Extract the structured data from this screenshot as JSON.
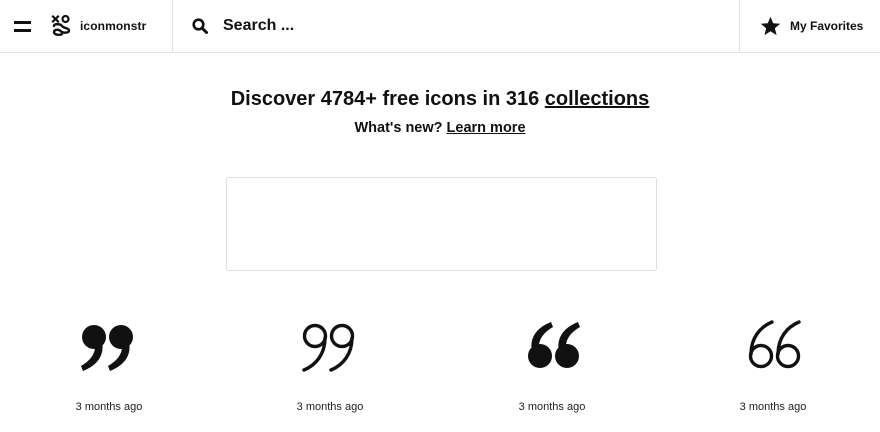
{
  "header": {
    "menu_icon": "hamburger-icon",
    "logo_icon": "iconmonstr-logo-icon",
    "logo_text": "iconmonstr",
    "search_icon": "search-icon",
    "search_placeholder": "Search ...",
    "favorites_icon": "star-icon",
    "favorites_label": "My Favorites"
  },
  "hero": {
    "title_prefix": "Discover 4784+ free icons in 316 ",
    "title_link": "collections",
    "subtitle_prefix": "What's new? ",
    "subtitle_link": "Learn more"
  },
  "icons": [
    {
      "icon": "quote-right-filled-icon",
      "time": "3 months ago"
    },
    {
      "icon": "quote-right-outline-icon",
      "time": "3 months ago"
    },
    {
      "icon": "quote-left-filled-icon",
      "time": "3 months ago"
    },
    {
      "icon": "quote-left-outline-icon",
      "time": "3 months ago"
    }
  ],
  "colors": {
    "text": "#111111",
    "border": "#e3e3e3",
    "background": "#ffffff"
  }
}
